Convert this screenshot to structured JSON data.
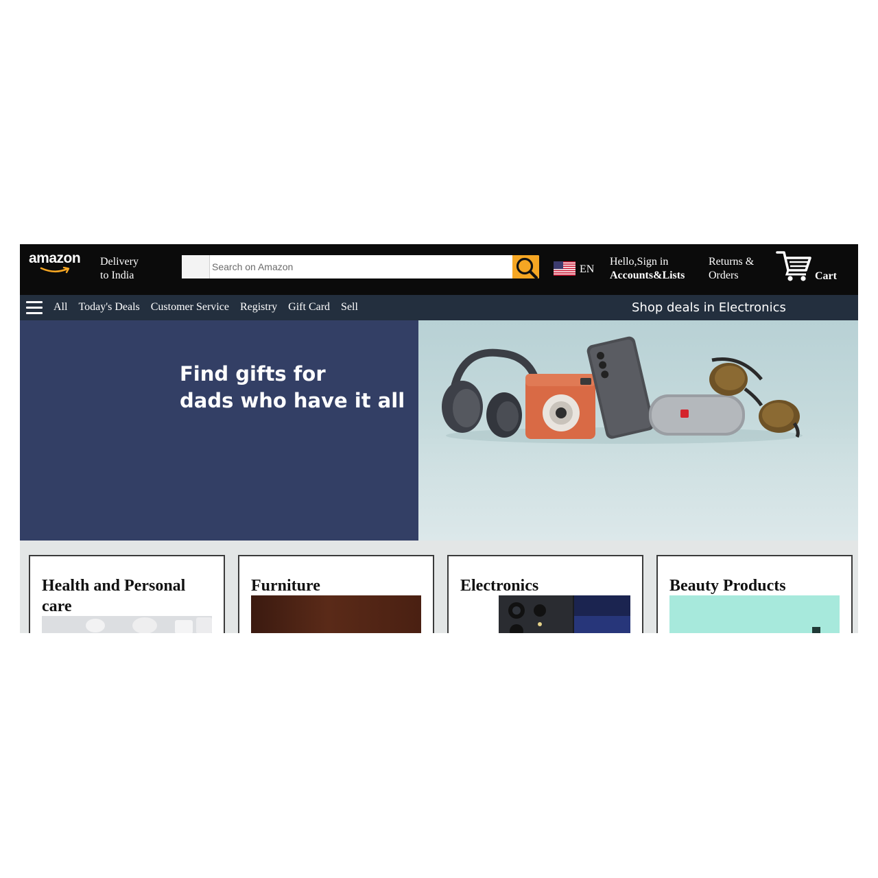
{
  "header": {
    "logo_text": "amazon",
    "delivery": {
      "line1": "Delivery",
      "line2": "to India"
    },
    "search": {
      "placeholder": "Search on Amazon",
      "value": ""
    },
    "language": {
      "code": "EN",
      "flag": "us-flag-icon"
    },
    "account": {
      "line1": "Hello,Sign in",
      "line2": "Accounts&Lists"
    },
    "returns": {
      "line1": "Returns &",
      "line2": "Orders"
    },
    "cart": {
      "label": "Cart"
    }
  },
  "subnav": {
    "links": [
      {
        "label": "All"
      },
      {
        "label": "Today's Deals"
      },
      {
        "label": "Customer Service"
      },
      {
        "label": "Registry"
      },
      {
        "label": "Gift Card"
      },
      {
        "label": "Sell"
      }
    ],
    "promo": "Shop deals in Electronics"
  },
  "hero": {
    "line1": "Find gifts for",
    "line2": "dads who have it all"
  },
  "categories": [
    {
      "title": "Health and Personal care"
    },
    {
      "title": "Furniture"
    },
    {
      "title": "Electronics"
    },
    {
      "title": "Beauty Products"
    }
  ],
  "colors": {
    "header_bg": "#0b0b0b",
    "subnav_bg": "#232f3e",
    "hero_left_bg": "#333f65",
    "search_button": "#f5a623",
    "page_bg": "#e3e6e6"
  }
}
